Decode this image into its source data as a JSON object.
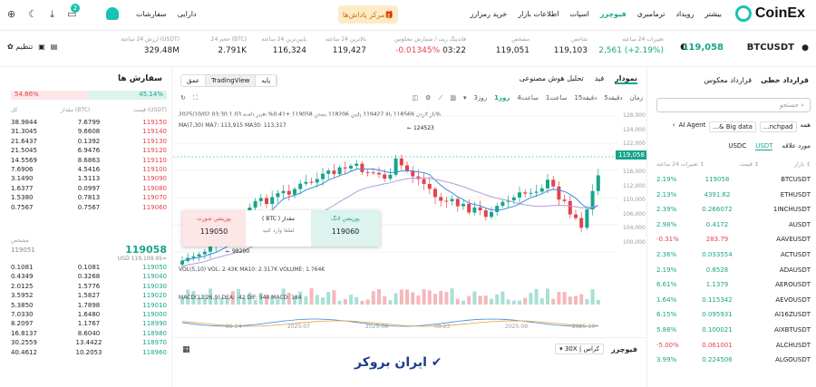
{
  "nav": {
    "logo": "CoinEx",
    "items": [
      "خرید رمزارز",
      "اطلاعات بازار",
      "اسپات",
      "فیوچرز",
      "ترمامبری",
      "رویداد",
      "بیشتر"
    ],
    "promo": "مرکز پاداش‌ها",
    "assets": "دارایی",
    "orders": "سفارشات",
    "notif_count": "2"
  },
  "ticker": {
    "symbol": "BTCUSDT",
    "price": "119,058",
    "change_label": "تغییرات 24 ساعته",
    "change_value": "2,561 (+2.19%)",
    "index_label": "شاخص",
    "index_value": "119,103",
    "mark_label": "مشخص",
    "mark_value": "119,051",
    "funding_label": "فاندینگ ریت / شمارش معکوس",
    "funding_value": "-0.01345%",
    "funding_time": "03:22",
    "high_label": "بالاترین 24 ساعته",
    "high_value": "119,427",
    "low_label": "پایین‌ترین 24 ساعته",
    "low_value": "116,324",
    "vol_btc_label": "حجم 24 (BTC)",
    "vol_btc_value": "2.791K",
    "vol_usdt_label": "ارزش 24 ساعته (USDT)",
    "vol_usdt_value": "329.48M",
    "settings": "تنظیم"
  },
  "orderbook": {
    "title": "سفارش ها",
    "sell_pct": "54.86%",
    "buy_pct": "45.14%",
    "col_price": "قیمت (USDT)",
    "col_amount": "مقدار (BTC)",
    "col_total": "کل",
    "asks": [
      [
        "119150",
        "7.6799",
        "38.9844"
      ],
      [
        "119140",
        "9.6608",
        "31.3045"
      ],
      [
        "119130",
        "0.1392",
        "21.6437"
      ],
      [
        "119120",
        "6.9476",
        "21.5045"
      ],
      [
        "119110",
        "8.6863",
        "14.5569"
      ],
      [
        "119100",
        "4.5416",
        "7.6906"
      ],
      [
        "119090",
        "1.5113",
        "3.1490"
      ],
      [
        "119080",
        "0.0997",
        "1.6377"
      ],
      [
        "119070",
        "0.7813",
        "1.5380"
      ],
      [
        "119060",
        "0.7567",
        "0.7567"
      ]
    ],
    "mid_price": "119058",
    "mid_label": "مشخص",
    "mid_mark": "119051",
    "mid_usd": "USD 119,109.95≈",
    "bids": [
      [
        "119050",
        "0.1081",
        "0.1081"
      ],
      [
        "119040",
        "0.3268",
        "0.4349"
      ],
      [
        "119030",
        "1.5776",
        "2.0125"
      ],
      [
        "119020",
        "1.5827",
        "3.5952"
      ],
      [
        "119010",
        "1.7898",
        "5.3850"
      ],
      [
        "119000",
        "1.6480",
        "7.0330"
      ],
      [
        "118990",
        "1.1767",
        "8.2097"
      ],
      [
        "118980",
        "8.6040",
        "16.8137"
      ],
      [
        "118970",
        "13.4422",
        "30.2559"
      ],
      [
        "118960",
        "10.2053",
        "40.4612"
      ]
    ]
  },
  "chart": {
    "tabs": [
      "نمودار",
      "فید",
      "تحلیل هوش مصنوعی"
    ],
    "view_tabs": [
      "پایه",
      "TradingView",
      "عمق"
    ],
    "intervals": [
      "زمان",
      "5دقیقه",
      "15دقیقه",
      "1ساعت",
      "4ساعت",
      "1روز",
      "3روز"
    ],
    "ohlc": "2025/10/02 03:30  باز کردن 118569  بالا 119427  پایین 118206  بستن 119058  +0.41% تغییر  دامنه 1.03%",
    "ma": "MA(7,30)  MA7: 113,915  MA30: 113,317",
    "high_label": "124523",
    "low_label": "98200",
    "last_tag": "119,058",
    "y_labels": [
      "128,000",
      "124,000",
      "122,000",
      "118,000",
      "116,000",
      "112,000",
      "110,000",
      "106,000",
      "104,000",
      "100,000"
    ],
    "vol": "VOL(5,10)  VOL: 2.43K  MA10: 2.317K  VOLUME: 1.764K",
    "macd": "MACD(12,26,9)  DEA: -42  DIF: 544  MACD: 184",
    "x_labels": [
      "06-24",
      "2025-07",
      "2025-08",
      "08-23",
      "2025-09",
      "2025-10"
    ],
    "popup_short_label": "پوزیشن شورت",
    "popup_short_price": "119050",
    "popup_qty_label": "( BTC ) مقدار",
    "popup_qty_hint": "لطفا وارد کنید",
    "popup_long_label": "پوزیشن لانگ",
    "popup_long_price": "119060",
    "watermark": "ایران بروکر"
  },
  "futures_bar": {
    "label": "فیوچرز",
    "mode": "کراس",
    "leverage": "30X"
  },
  "right": {
    "tabs": [
      "قرارداد خطی",
      "قرارداد معکوس"
    ],
    "search_placeholder": "جستجو",
    "chips": [
      "همه",
      "...nchpad",
      "...& Big data",
      "AI Agent"
    ],
    "cur_tabs": [
      "مورد علاقه",
      "USDT",
      "USDC"
    ],
    "col_pair": "بازار ↕",
    "col_price": "قیمت ↕",
    "col_change": "تغییرات 24 ساعته ↕",
    "rows": [
      [
        "BTCUSDT",
        "119058",
        "2.19%"
      ],
      [
        "ETHUSDT",
        "4391.62",
        "2.13%"
      ],
      [
        "1INCHUSDT",
        "0.266072",
        "2.39%"
      ],
      [
        "AUSDT",
        "0.4172",
        "2.98%"
      ],
      [
        "AAVEUSDT",
        "283.79",
        "-0.31%"
      ],
      [
        "ACTUSDT",
        "0.033554",
        "2.36%"
      ],
      [
        "ADAUSDT",
        "0.8528",
        "2.19%"
      ],
      [
        "AEROUSDT",
        "1.1379",
        "6.61%"
      ],
      [
        "AEVOUSDT",
        "0.115342",
        "1.64%"
      ],
      [
        "AI16ZUSDT",
        "0.095931",
        "6.15%"
      ],
      [
        "AIXBTUSDT",
        "0.100021",
        "5.88%"
      ],
      [
        "ALCHUSDT",
        "0.061001",
        "-5.00%"
      ],
      [
        "ALGOUSDT",
        "0.224506",
        "3.99%"
      ]
    ]
  }
}
